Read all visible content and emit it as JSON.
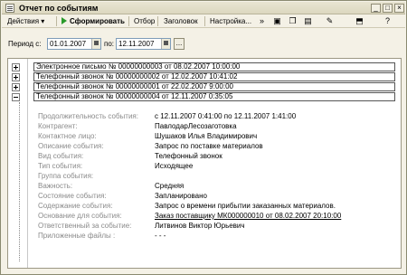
{
  "window": {
    "title": "Отчет по событиям"
  },
  "toolbar": {
    "actions_label": "Действия",
    "generate_label": "Сформировать",
    "filter_label": "Отбор",
    "header_label": "Заголовок",
    "settings_label": "Настройка..."
  },
  "period": {
    "from_label": "Период с:",
    "from_value": "01.01.2007",
    "to_label": "по:",
    "to_value": "12.11.2007"
  },
  "events": [
    "Электронное письмо № 00000000003 от 08.02.2007 10:00:00",
    "Телефонный звонок № 00000000002 от 12.02.2007 10:41:02",
    "Телефонный звонок № 00000000001 от 22.02.2007 9:00:00",
    "Телефонный звонок № 00000000004 от 12.11.2007 0:35:05"
  ],
  "details": [
    {
      "label": "Продолжительность события:",
      "value": "с 12.11.2007 0:41:00 по 12.11.2007 1:41:00"
    },
    {
      "label": "Контрагент:",
      "value": "ПавлодарЛесозаготовка"
    },
    {
      "label": "Контактное лицо:",
      "value": "Шушаков Илья Владимирович"
    },
    {
      "label": "Описание события:",
      "value": "Запрос по поставке материалов"
    },
    {
      "label": "Вид события:",
      "value": "Телефонный звонок"
    },
    {
      "label": "Тип события:",
      "value": "Исходящее"
    },
    {
      "label": "Группа события:",
      "value": ""
    },
    {
      "label": "Важность:",
      "value": "Средняя"
    },
    {
      "label": "Состояние события:",
      "value": "Запланировано"
    },
    {
      "label": "Содержание события:",
      "value": "Запрос о времени прибытии заказанных материалов."
    },
    {
      "label": "Основание для события:",
      "value": "Заказ поставщику МК000000010 от 08.02.2007 20:10:00"
    },
    {
      "label": "Ответственный за событие:",
      "value": "Литвинов Виктор Юрьевич"
    },
    {
      "label": "Приложенные файлы :",
      "value": "- - -"
    }
  ]
}
